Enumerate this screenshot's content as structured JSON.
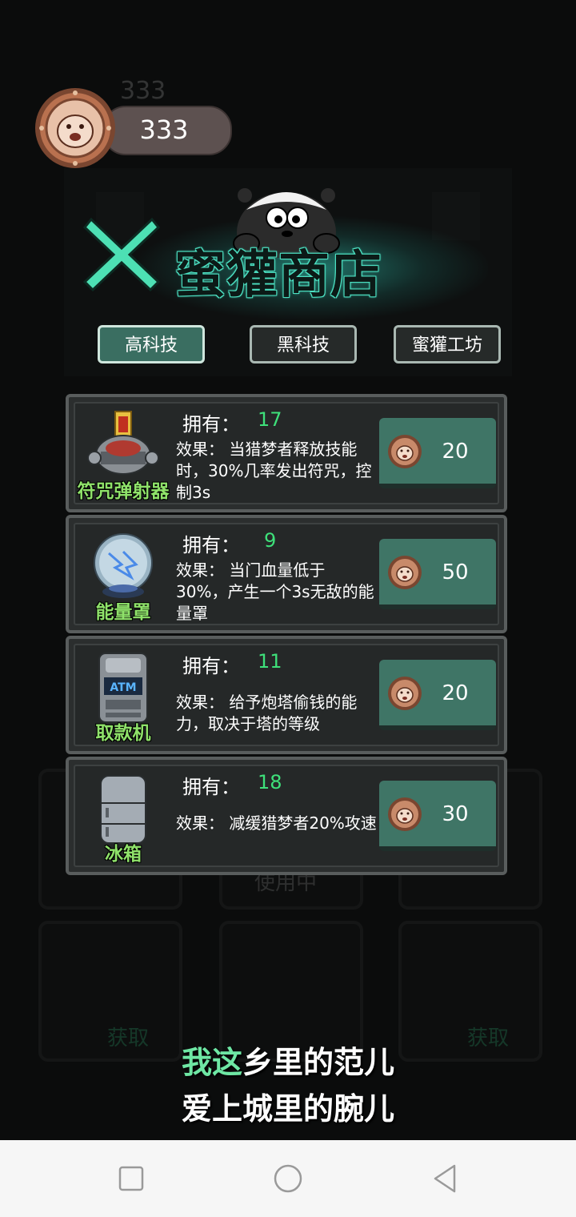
{
  "header": {
    "coins": "333",
    "coins_ghost": "333"
  },
  "shop": {
    "title": "蜜獾商店",
    "tabs": [
      {
        "label": "高科技",
        "active": true
      },
      {
        "label": "黑科技",
        "active": false
      },
      {
        "label": "蜜獾工坊",
        "active": false
      }
    ],
    "own_label": "拥有：",
    "items": [
      {
        "name": "符咒弹射器",
        "owned": "17",
        "effect": "效果：    当猎梦者释放技能时，30%几率发出符咒，控制3s",
        "price": "20",
        "icon": "talisman-launcher-icon"
      },
      {
        "name": "能量罩",
        "owned": "9",
        "effect": "效果：    当门血量低于30%，产生一个3s无敌的能量罩",
        "price": "50",
        "icon": "energy-shield-orb-icon"
      },
      {
        "name": "取款机",
        "owned": "11",
        "effect": "效果：    给予炮塔偷钱的能力，取决于塔的等级",
        "price": "20",
        "icon": "atm-machine-icon"
      },
      {
        "name": "冰箱",
        "owned": "18",
        "effect": "效果：    减缓猎梦者20%攻速",
        "price": "30",
        "icon": "refrigerator-icon"
      }
    ]
  },
  "background": {
    "using_label": "使用中",
    "obtain_label": "获取"
  },
  "subtitles": {
    "line1_highlight": "我这",
    "line1_rest": "乡里的范儿",
    "line2": "爱上城里的腕儿"
  },
  "colors": {
    "accent_teal": "#3f7566",
    "owned_green": "#3ee07a",
    "name_green": "#8fe26a",
    "close_x": "#4de0b4"
  }
}
